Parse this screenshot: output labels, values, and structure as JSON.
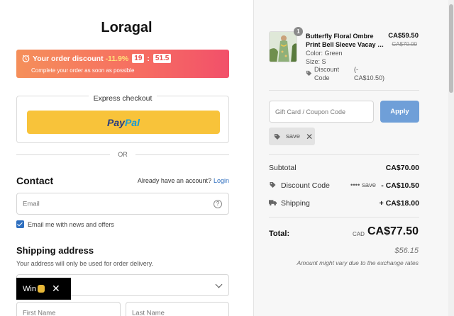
{
  "store": {
    "name": "Loragal"
  },
  "banner": {
    "label": "Your order discount",
    "percent": "-11.9%",
    "countdown_minutes": "19",
    "countdown_sep": ":",
    "countdown_seconds": "51.5",
    "subtitle": "Complete your order as soon as possible"
  },
  "express": {
    "title": "Express checkout",
    "paypal_pay": "Pay",
    "paypal_pal": "Pal"
  },
  "divider": {
    "or": "OR"
  },
  "contact": {
    "heading": "Contact",
    "account_prompt": "Already have an account?",
    "login_link": "Login",
    "email_placeholder": "Email",
    "help_symbol": "?",
    "newsletter_label": "Email me with news and offers",
    "newsletter_checked": true
  },
  "shipping": {
    "heading": "Shipping address",
    "subtitle": "Your address will only be used for order delivery.",
    "first_name_placeholder": "First Name",
    "last_name_placeholder": "Last Name"
  },
  "popup": {
    "label": "Win",
    "close": "✕"
  },
  "product": {
    "quantity": "1",
    "name_line1": "Butterfly Floral Ombre",
    "name_line2": "Print Bell Sleeve Vacay Ma...",
    "price": "CA$59.50",
    "old_price": "CA$70.00",
    "color": "Color: Green",
    "size": "Size: S",
    "discount_label": "Discount Code",
    "discount_amount": "(-CA$10.50)"
  },
  "coupon": {
    "placeholder": "Gift Card / Coupon Code",
    "apply_label": "Apply",
    "applied_code": "save",
    "remove_symbol": "✕"
  },
  "summary": {
    "subtotal_label": "Subtotal",
    "subtotal_value": "CA$70.00",
    "discount_label": "Discount Code",
    "discount_code": "•••• save",
    "discount_value": "- CA$10.50",
    "shipping_label": "Shipping",
    "shipping_value": "+ CA$18.00",
    "total_label": "Total:",
    "currency": "CAD",
    "total_value": "CA$77.50",
    "alt_price": "$56.15",
    "note": "Amount might vary due to the exchange rates"
  },
  "colors": {
    "accent": "#2f6fbf",
    "apply_button": "#6f9fd8",
    "paypal_button": "#f8c33a",
    "banner_start": "#f58f5a",
    "banner_end": "#f2506a"
  },
  "icons": [
    "clock-icon",
    "help-icon",
    "checkbox-checked-icon",
    "chevron-down-icon",
    "coin-icon",
    "close-icon",
    "tag-icon",
    "truck-icon"
  ]
}
